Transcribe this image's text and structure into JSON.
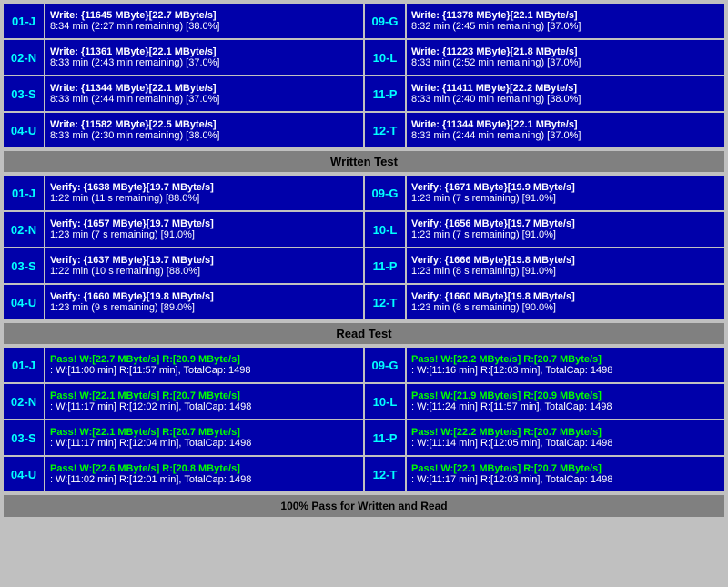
{
  "sections": {
    "written_test": {
      "header": "Written Test",
      "rows": [
        {
          "left_label": "01-J",
          "left_line1": "Write: {11645 MByte}[22.7 MByte/s]",
          "left_line2": "8:34 min (2:27 min remaining)  [38.0%]",
          "right_label": "09-G",
          "right_line1": "Write: {11378 MByte}[22.1 MByte/s]",
          "right_line2": "8:32 min (2:45 min remaining)  [37.0%]"
        },
        {
          "left_label": "02-N",
          "left_line1": "Write: {11361 MByte}[22.1 MByte/s]",
          "left_line2": "8:33 min (2:43 min remaining)  [37.0%]",
          "right_label": "10-L",
          "right_line1": "Write: {11223 MByte}[21.8 MByte/s]",
          "right_line2": "8:33 min (2:52 min remaining)  [37.0%]"
        },
        {
          "left_label": "03-S",
          "left_line1": "Write: {11344 MByte}[22.1 MByte/s]",
          "left_line2": "8:33 min (2:44 min remaining)  [37.0%]",
          "right_label": "11-P",
          "right_line1": "Write: {11411 MByte}[22.2 MByte/s]",
          "right_line2": "8:33 min (2:40 min remaining)  [38.0%]"
        },
        {
          "left_label": "04-U",
          "left_line1": "Write: {11582 MByte}[22.5 MByte/s]",
          "left_line2": "8:33 min (2:30 min remaining)  [38.0%]",
          "right_label": "12-T",
          "right_line1": "Write: {11344 MByte}[22.1 MByte/s]",
          "right_line2": "8:33 min (2:44 min remaining)  [37.0%]"
        }
      ]
    },
    "verify_test": {
      "rows": [
        {
          "left_label": "01-J",
          "left_line1": "Verify: {1638 MByte}[19.7 MByte/s]",
          "left_line2": "1:22 min (11 s remaining)   [88.0%]",
          "right_label": "09-G",
          "right_line1": "Verify: {1671 MByte}[19.9 MByte/s]",
          "right_line2": "1:23 min (7 s remaining)   [91.0%]"
        },
        {
          "left_label": "02-N",
          "left_line1": "Verify: {1657 MByte}[19.7 MByte/s]",
          "left_line2": "1:23 min (7 s remaining)   [91.0%]",
          "right_label": "10-L",
          "right_line1": "Verify: {1656 MByte}[19.7 MByte/s]",
          "right_line2": "1:23 min (7 s remaining)   [91.0%]"
        },
        {
          "left_label": "03-S",
          "left_line1": "Verify: {1637 MByte}[19.7 MByte/s]",
          "left_line2": "1:22 min (10 s remaining)  [88.0%]",
          "right_label": "11-P",
          "right_line1": "Verify: {1666 MByte}[19.8 MByte/s]",
          "right_line2": "1:23 min (8 s remaining)   [91.0%]"
        },
        {
          "left_label": "04-U",
          "left_line1": "Verify: {1660 MByte}[19.8 MByte/s]",
          "left_line2": "1:23 min (9 s remaining)   [89.0%]",
          "right_label": "12-T",
          "right_line1": "Verify: {1660 MByte}[19.8 MByte/s]",
          "right_line2": "1:23 min (8 s remaining)   [90.0%]"
        }
      ]
    },
    "read_test": {
      "header": "Read Test",
      "rows": [
        {
          "left_label": "01-J",
          "left_pass": "Pass! W:[22.7 MByte/s] R:[20.9 MByte/s]",
          "left_detail": ": W:[11:00 min] R:[11:57 min], TotalCap: 1498",
          "right_label": "09-G",
          "right_pass": "Pass! W:[22.2 MByte/s] R:[20.7 MByte/s]",
          "right_detail": ": W:[11:16 min] R:[12:03 min], TotalCap: 1498"
        },
        {
          "left_label": "02-N",
          "left_pass": "Pass! W:[22.1 MByte/s] R:[20.7 MByte/s]",
          "left_detail": ": W:[11:17 min] R:[12:02 min], TotalCap: 1498",
          "right_label": "10-L",
          "right_pass": "Pass! W:[21.9 MByte/s] R:[20.9 MByte/s]",
          "right_detail": ": W:[11:24 min] R:[11:57 min], TotalCap: 1498"
        },
        {
          "left_label": "03-S",
          "left_pass": "Pass! W:[22.1 MByte/s] R:[20.7 MByte/s]",
          "left_detail": ": W:[11:17 min] R:[12:04 min], TotalCap: 1498",
          "right_label": "11-P",
          "right_pass": "Pass! W:[22.2 MByte/s] R:[20.7 MByte/s]",
          "right_detail": ": W:[11:14 min] R:[12:05 min], TotalCap: 1498"
        },
        {
          "left_label": "04-U",
          "left_pass": "Pass! W:[22.6 MByte/s] R:[20.8 MByte/s]",
          "left_detail": ": W:[11:02 min] R:[12:01 min], TotalCap: 1498",
          "right_label": "12-T",
          "right_pass": "Pass! W:[22.1 MByte/s] R:[20.7 MByte/s]",
          "right_detail": ": W:[11:17 min] R:[12:03 min], TotalCap: 1498"
        }
      ]
    },
    "footer": "100% Pass for Written and Read"
  }
}
